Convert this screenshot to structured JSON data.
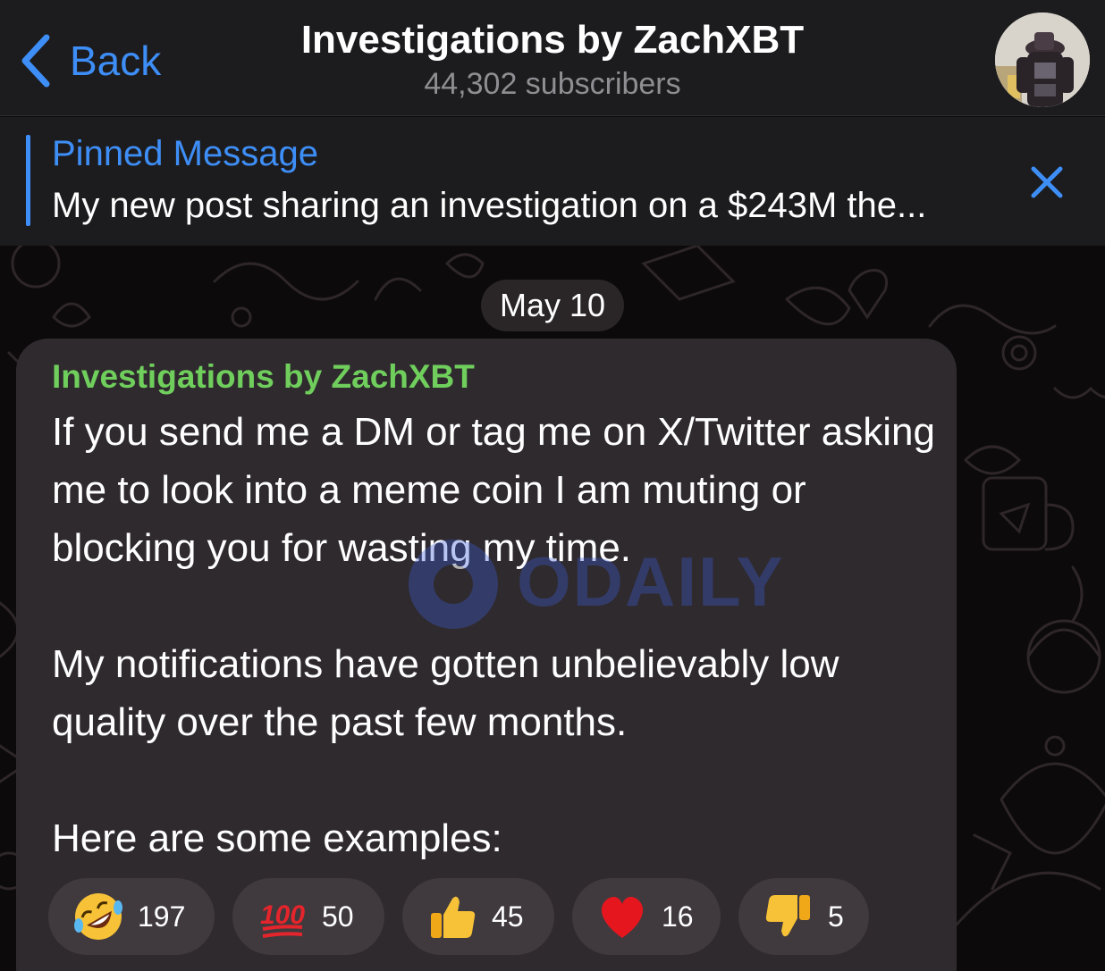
{
  "header": {
    "back_label": "Back",
    "title": "Investigations by ZachXBT",
    "subtitle": "44,302 subscribers"
  },
  "pinned": {
    "title": "Pinned Message",
    "text": "My new post sharing an investigation on a $243M the..."
  },
  "chat": {
    "date": "May 10",
    "message": {
      "sender": "Investigations by ZachXBT",
      "text": "If you send me a DM or tag me on X/Twitter asking me to look into a meme coin I am muting or blocking you for wasting my time.\n\nMy notifications have gotten unbelievably low quality over the past few months.\n\nHere are some examples:",
      "reactions": [
        {
          "emoji": "rolling-on-floor-laughing",
          "count": "197"
        },
        {
          "emoji": "hundred-points",
          "count": "50"
        },
        {
          "emoji": "thumbs-up",
          "count": "45"
        },
        {
          "emoji": "red-heart",
          "count": "16"
        },
        {
          "emoji": "thumbs-down",
          "count": "5"
        }
      ]
    }
  },
  "watermark": {
    "text": "ODAILY"
  },
  "colors": {
    "accent": "#3e8ef7",
    "sender": "#6fce5c",
    "header_bg": "#1c1c1e",
    "bubble_bg": "#2f2a2e",
    "reaction_bg": "#403a3e"
  }
}
